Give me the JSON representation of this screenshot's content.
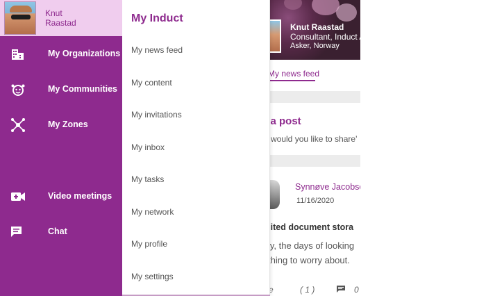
{
  "user": {
    "first_name": "Knut",
    "last_name": "Raastad"
  },
  "sidebar": {
    "items": [
      {
        "label": "My Organizations",
        "icon": "building-icon"
      },
      {
        "label": "My Communities",
        "icon": "community-icon"
      },
      {
        "label": "My Zones",
        "icon": "zones-icon"
      },
      {
        "label": "Video meetings",
        "icon": "video-add-icon"
      },
      {
        "label": "Chat",
        "icon": "chat-icon"
      }
    ]
  },
  "dropdown": {
    "title": "My Induct",
    "items": [
      "My news feed",
      "My content",
      "My invitations",
      "My inbox",
      "My tasks",
      "My network",
      "My profile",
      "My settings"
    ]
  },
  "background": {
    "profile": {
      "name": "Knut Raastad",
      "role": "Consultant, Induct A",
      "location": "Asker, Norway"
    },
    "tab": "My news feed",
    "post_title": "e a post",
    "post_prompt": "would you like to share'",
    "author": "Synnøve Jacobse",
    "date": "11/16/2020",
    "headline": "nited document stora",
    "line1": "ly, the days of looking",
    "line2": "thing to worry about.",
    "like_label": "ke",
    "like_count": "( 1 )",
    "comment_count": "0"
  },
  "colors": {
    "brand_purple": "#8e2a8e",
    "user_bar": "#f0cdee"
  }
}
